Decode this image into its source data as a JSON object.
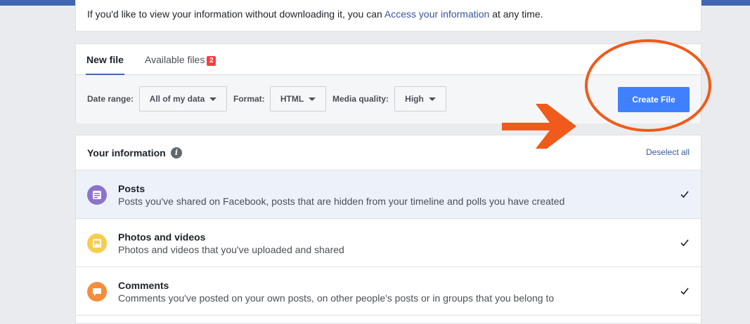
{
  "info_box": {
    "text_before": "If you'd like to view your information without downloading it, you can ",
    "link": "Access your information",
    "text_after": " at any time."
  },
  "tabs": {
    "new_file": "New file",
    "available_files": "Available files",
    "available_count": "2"
  },
  "filters": {
    "date_range_label": "Date range:",
    "date_range_value": "All of my data",
    "format_label": "Format:",
    "format_value": "HTML",
    "media_quality_label": "Media quality:",
    "media_quality_value": "High"
  },
  "create_file_label": "Create File",
  "your_information": {
    "title": "Your information",
    "deselect_all": "Deselect all",
    "items": [
      {
        "title": "Posts",
        "description": "Posts you've shared on Facebook, posts that are hidden from your timeline and polls you have created",
        "icon": "posts-icon",
        "color": "#8c72cb"
      },
      {
        "title": "Photos and videos",
        "description": "Photos and videos that you've uploaded and shared",
        "icon": "photo-icon",
        "color": "#f7cd4e"
      },
      {
        "title": "Comments",
        "description": "Comments you've posted on your own posts, on other people's posts or in groups that you belong to",
        "icon": "comment-icon",
        "color": "#f58d3a"
      }
    ]
  },
  "colors": {
    "brand": "#4267b2",
    "button": "#4080ff",
    "annotation": "#f05a1a",
    "badge": "#fa3e3e"
  }
}
